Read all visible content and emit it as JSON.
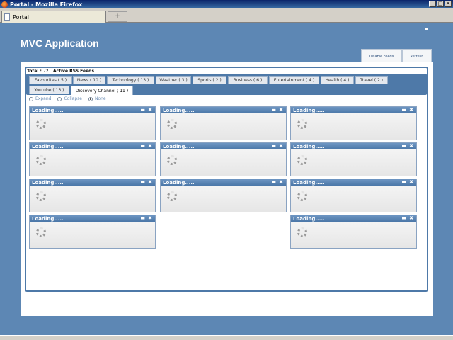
{
  "window": {
    "title": "Portal - Mozilla Firefox",
    "controls": [
      "_",
      "□",
      "✕"
    ]
  },
  "browser": {
    "tab_label": "Portal",
    "new_tab_symbol": "+"
  },
  "app": {
    "title": "MVC Application",
    "disable_feeds_label": "Disable Feeds",
    "refresh_label": "Refresh"
  },
  "summary": {
    "total_label": "Total :",
    "total_count": "72",
    "active_label": "Active RSS Feeds"
  },
  "tabs": [
    {
      "label": "Favourites ( 5 )"
    },
    {
      "label": "News ( 10 )"
    },
    {
      "label": "Technology ( 13 )"
    },
    {
      "label": "Weather ( 3 )"
    },
    {
      "label": "Sports ( 2 )"
    },
    {
      "label": "Business ( 6 )"
    },
    {
      "label": "Entertainment ( 4 )"
    },
    {
      "label": "Health ( 4 )"
    },
    {
      "label": "Travel ( 2 )"
    },
    {
      "label": "Youtube ( 13 )"
    },
    {
      "label": "Discovery Channel ( 11 )"
    }
  ],
  "active_tab": "Discovery Channel ( 11 )",
  "view_options": [
    {
      "label": "Expand",
      "checked": false
    },
    {
      "label": "Collapse",
      "checked": false
    },
    {
      "label": "None",
      "checked": true
    }
  ],
  "widget": {
    "loading_text": "Loading.....",
    "minimize_symbol": "▬",
    "close_symbol": "✖"
  },
  "widgets_count": 11
}
